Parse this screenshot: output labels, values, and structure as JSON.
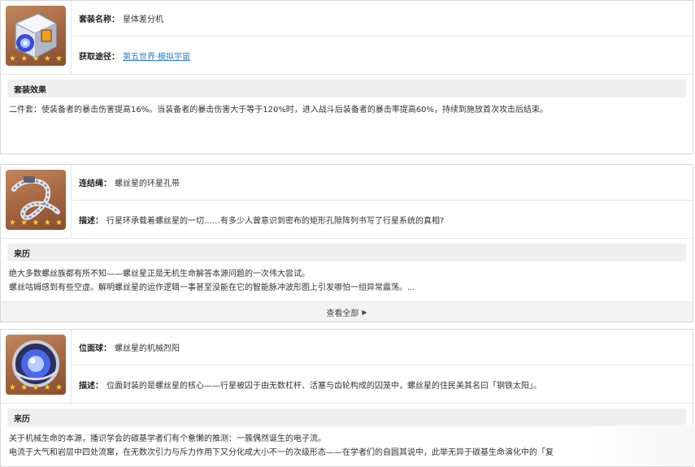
{
  "cards": [
    {
      "rows": [
        {
          "label": "套装名称：",
          "value": "星体差分机"
        },
        {
          "label": "获取途径：",
          "link": "第五世界·模拟宇宙"
        }
      ],
      "stars": 5,
      "icon": "differential-engine-icon",
      "section_title": "套装效果",
      "lines": [
        "二件套：使装备者的暴击伤害提高16%。当装备者的暴击伤害大于等于120%时，进入战斗后装备者的暴击率提高60%，持续到施放首次攻击后结束。"
      ]
    },
    {
      "rows": [
        {
          "label": "连结绳：",
          "value": "螺丝星的环星孔带"
        },
        {
          "label": "描述：",
          "value": "行星环承载着螺丝星的一切……有多少人曾意识到密布的矩形孔隙阵列书写了行星系统的真相?"
        }
      ],
      "stars": 5,
      "icon": "ring-belt-icon",
      "section_title": "来历",
      "lines": [
        "绝大多数螺丝族都有所不知——螺丝星正是无机生命解答本源问题的一次伟大尝试。",
        "螺丝咕姆感到有些空虚。解明螺丝星的运作逻辑一事甚至没能在它的智能脉冲波形图上引发哪怕一组异常震荡。..."
      ],
      "more_label": "查看全部"
    },
    {
      "rows": [
        {
          "label": "位面球：",
          "value": "螺丝星的机械烈阳"
        },
        {
          "label": "描述：",
          "value": "位面封装的是螺丝星的核心——行星被囚于由无数杠杆、活塞与齿轮构成的囚笼中，螺丝星的住民美其名曰「钢铁太阳」。"
        }
      ],
      "stars": 5,
      "icon": "mechanical-sun-sphere-icon",
      "section_title": "来历",
      "lines": [
        "关于机械生命的本源，播识学会的碳基学者们有个惫懒的推测：一簇偶然诞生的电子流。",
        "电流于大气和岩层中四处流窜，在无数次引力与斥力作用下又分化成大小不一的次级形态——在学者们的自圆其说中，此举无异于碳基生命演化中的「复"
      ]
    }
  ],
  "colors": {
    "link": "#2a7fc8",
    "star": "#f6cf3b",
    "section_bg": "#efefef",
    "icon_bg": "#a0613c"
  }
}
